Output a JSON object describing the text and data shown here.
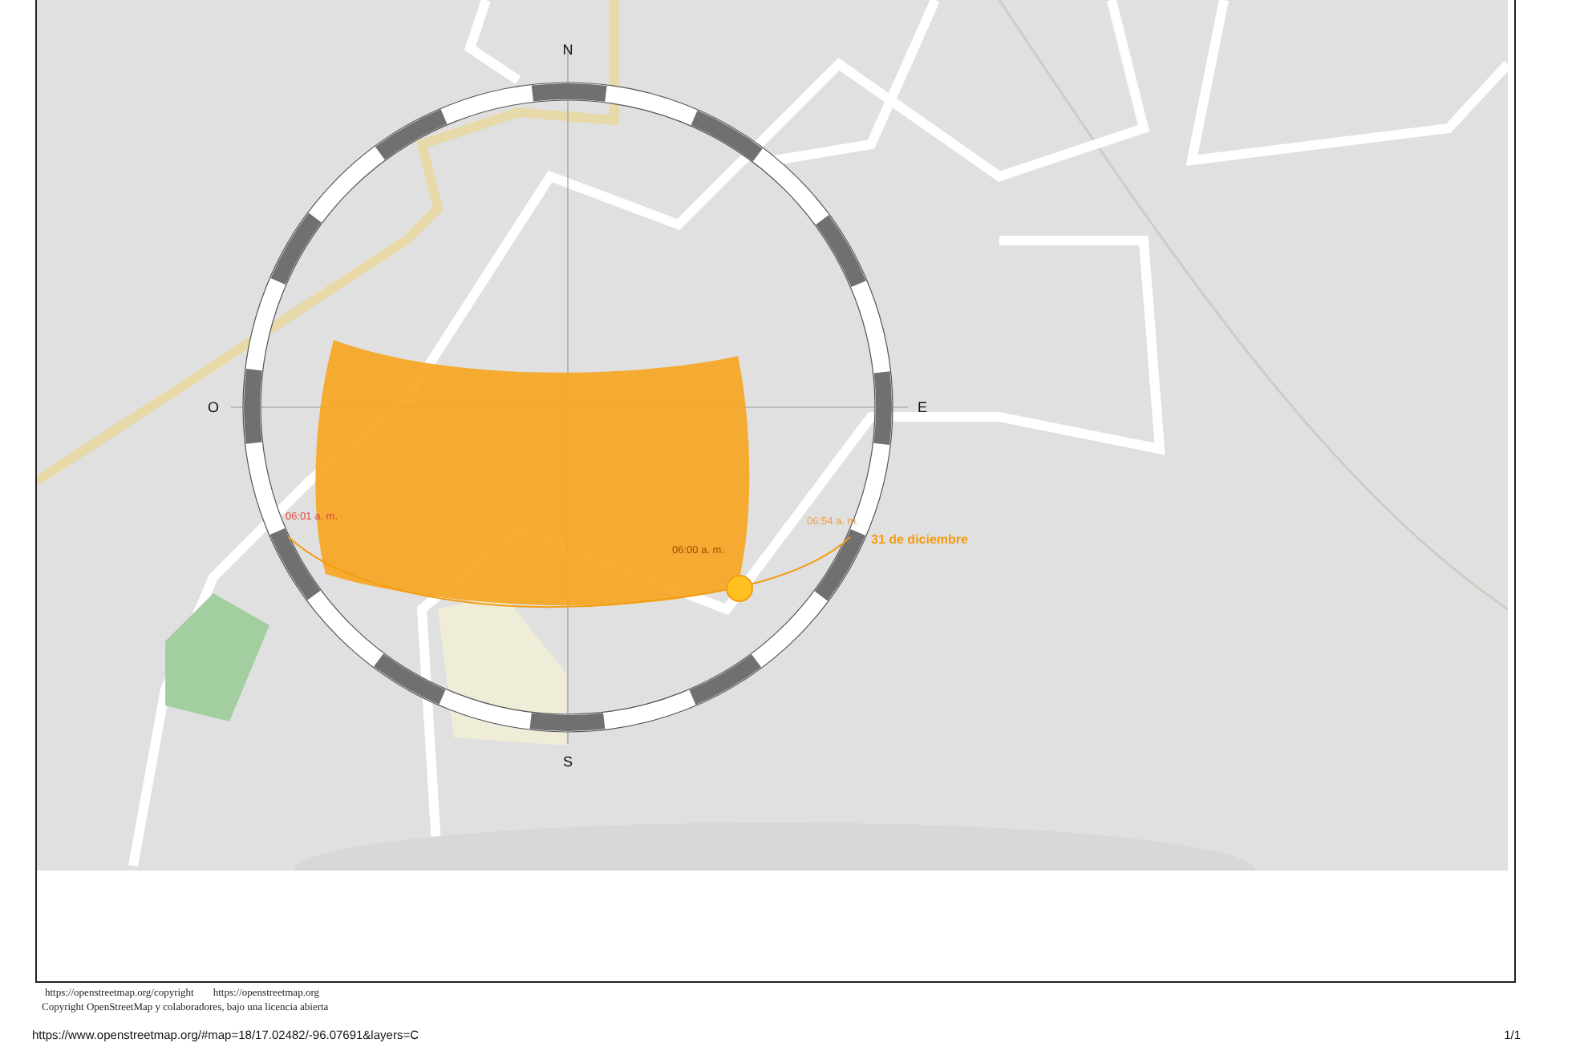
{
  "map": {
    "compass": [
      {
        "label": "N",
        "kind": "north"
      },
      {
        "label": "E",
        "kind": "east"
      },
      {
        "label": "S",
        "kind": "south"
      },
      {
        "label": "O",
        "kind": "west"
      }
    ],
    "time_labels": [
      {
        "text": "06:01 a. m.",
        "color": "#e0453a",
        "kind": "rise"
      },
      {
        "text": "06:54 a. m.",
        "color": "#f0a040",
        "kind": "set"
      },
      {
        "text": "06:00 a. m.",
        "color": "#a04a00",
        "kind": "now"
      }
    ],
    "date_label": "31 de diciembre"
  },
  "attribution": {
    "links": [
      "https://openstreetmap.org/copyright",
      "https://openstreetmap.org"
    ],
    "notice": "Copyright OpenStreetMap y colaboradores, bajo una licencia abierta"
  },
  "print_footer": {
    "url": "https://www.openstreetmap.org/#map=18/17.02482/-96.07691&layers=C",
    "page": "1/1"
  }
}
